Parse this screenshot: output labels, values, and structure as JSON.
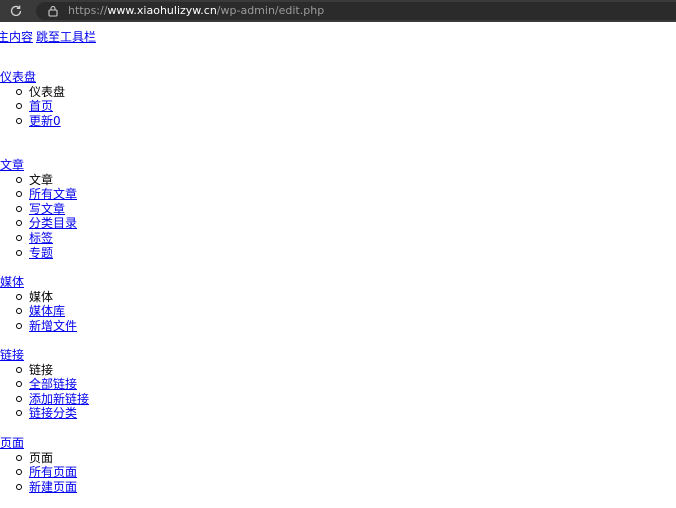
{
  "browser": {
    "url_scheme": "https://",
    "url_host": "www.xiaohulizyw.cn",
    "url_path": "/wp-admin/edit.php"
  },
  "skip_links": [
    "主内容",
    "跳至工具栏"
  ],
  "menu": [
    {
      "heading": "仪表盘",
      "items": [
        {
          "label": "仪表盘",
          "link": false
        },
        {
          "label": "首页",
          "link": true
        },
        {
          "label": "更新0",
          "link": true
        }
      ]
    },
    {
      "heading": "文章",
      "items": [
        {
          "label": "文章",
          "link": false
        },
        {
          "label": "所有文章",
          "link": true
        },
        {
          "label": "写文章",
          "link": true
        },
        {
          "label": "分类目录",
          "link": true
        },
        {
          "label": "标签",
          "link": true
        },
        {
          "label": "专题",
          "link": true
        }
      ]
    },
    {
      "heading": "媒体",
      "items": [
        {
          "label": "媒体",
          "link": false
        },
        {
          "label": "媒体库",
          "link": true
        },
        {
          "label": "新增文件",
          "link": true
        }
      ]
    },
    {
      "heading": "链接",
      "items": [
        {
          "label": "链接",
          "link": false
        },
        {
          "label": "全部链接",
          "link": true
        },
        {
          "label": "添加新链接",
          "link": true
        },
        {
          "label": "链接分类",
          "link": true
        }
      ]
    },
    {
      "heading": "页面",
      "items": [
        {
          "label": "页面",
          "link": false
        },
        {
          "label": "所有页面",
          "link": true
        },
        {
          "label": "新建页面",
          "link": true
        }
      ]
    }
  ]
}
